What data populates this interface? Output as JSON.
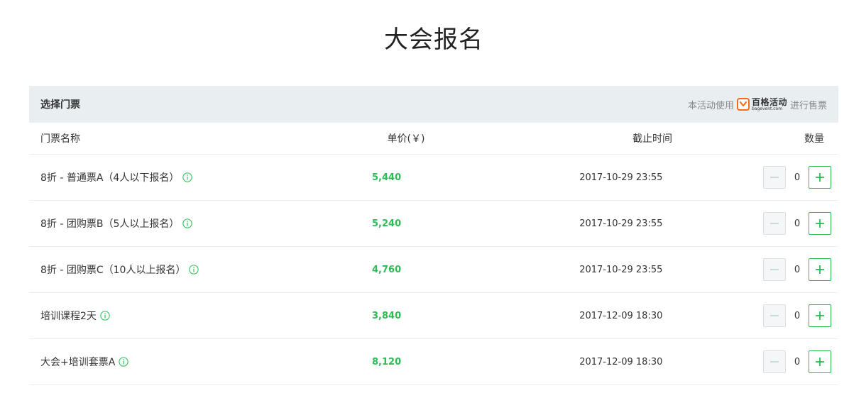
{
  "page": {
    "title": "大会报名"
  },
  "panel": {
    "title": "选择门票",
    "powered_prefix": "本活动使用",
    "brand_name": "百格活动",
    "brand_domain": "bagevent.com",
    "powered_suffix": "进行售票"
  },
  "columns": {
    "name": "门票名称",
    "price": "单价(￥)",
    "deadline": "截止时间",
    "quantity": "数量"
  },
  "tickets": [
    {
      "name": "8折 - 普通票A（4人以下报名）",
      "price": "5,440",
      "deadline": "2017-10-29 23:55",
      "quantity": "0"
    },
    {
      "name": "8折 - 团购票B（5人以上报名）",
      "price": "5,240",
      "deadline": "2017-10-29 23:55",
      "quantity": "0"
    },
    {
      "name": "8折 - 团购票C（10人以上报名）",
      "price": "4,760",
      "deadline": "2017-10-29 23:55",
      "quantity": "0"
    },
    {
      "name": "培训课程2天",
      "price": "3,840",
      "deadline": "2017-12-09 18:30",
      "quantity": "0"
    },
    {
      "name": "大会+培训套票A",
      "price": "8,120",
      "deadline": "2017-12-09 18:30",
      "quantity": "0"
    }
  ],
  "icons": {
    "info": "info-circle-icon",
    "minus": "minus-icon",
    "plus": "plus-icon",
    "brand": "bagevent-logo-icon"
  },
  "colors": {
    "accent_green": "#2dbb55",
    "header_bg": "#e9eef1",
    "brand_orange": "#f26a1b"
  }
}
